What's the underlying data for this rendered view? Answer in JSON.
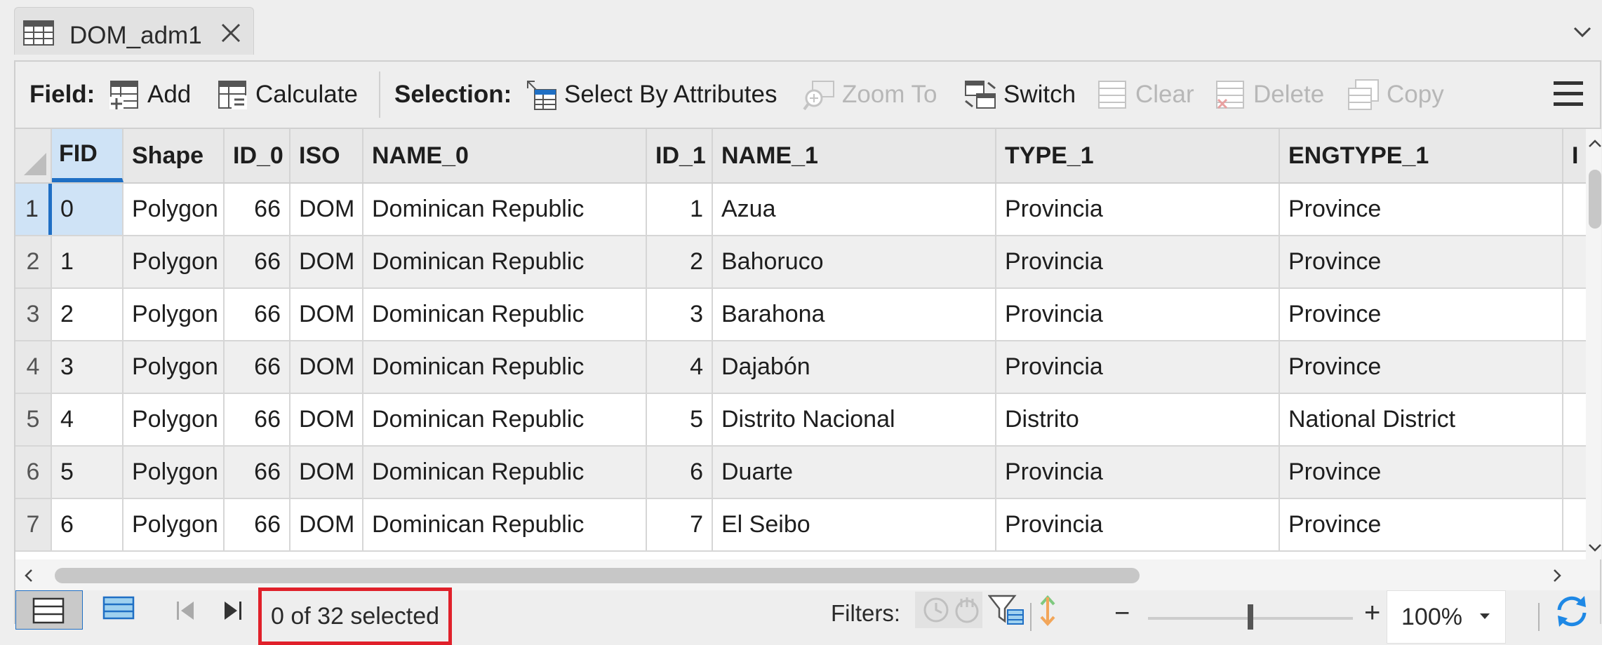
{
  "tab": {
    "title": "DOM_adm1",
    "icon": "table-icon",
    "close_icon": "close-icon"
  },
  "toolbar": {
    "field_label": "Field:",
    "add_label": "Add",
    "calculate_label": "Calculate",
    "selection_label": "Selection:",
    "select_by_attributes_label": "Select By Attributes",
    "zoom_to_label": "Zoom To",
    "switch_label": "Switch",
    "clear_label": "Clear",
    "delete_label": "Delete",
    "copy_label": "Copy"
  },
  "table": {
    "columns": [
      "FID",
      "Shape",
      "ID_0",
      "ISO",
      "NAME_0",
      "ID_1",
      "NAME_1",
      "TYPE_1",
      "ENGTYPE_1",
      "I"
    ],
    "rows": [
      {
        "n": "1",
        "FID": "0",
        "Shape": "Polygon",
        "ID_0": "66",
        "ISO": "DOM",
        "NAME_0": "Dominican Republic",
        "ID_1": "1",
        "NAME_1": "Azua",
        "TYPE_1": "Provincia",
        "ENGTYPE_1": "Province"
      },
      {
        "n": "2",
        "FID": "1",
        "Shape": "Polygon",
        "ID_0": "66",
        "ISO": "DOM",
        "NAME_0": "Dominican Republic",
        "ID_1": "2",
        "NAME_1": "Bahoruco",
        "TYPE_1": "Provincia",
        "ENGTYPE_1": "Province"
      },
      {
        "n": "3",
        "FID": "2",
        "Shape": "Polygon",
        "ID_0": "66",
        "ISO": "DOM",
        "NAME_0": "Dominican Republic",
        "ID_1": "3",
        "NAME_1": "Barahona",
        "TYPE_1": "Provincia",
        "ENGTYPE_1": "Province"
      },
      {
        "n": "4",
        "FID": "3",
        "Shape": "Polygon",
        "ID_0": "66",
        "ISO": "DOM",
        "NAME_0": "Dominican Republic",
        "ID_1": "4",
        "NAME_1": "Dajabón",
        "TYPE_1": "Provincia",
        "ENGTYPE_1": "Province"
      },
      {
        "n": "5",
        "FID": "4",
        "Shape": "Polygon",
        "ID_0": "66",
        "ISO": "DOM",
        "NAME_0": "Dominican Republic",
        "ID_1": "5",
        "NAME_1": "Distrito Nacional",
        "TYPE_1": "Distrito",
        "ENGTYPE_1": "National District"
      },
      {
        "n": "6",
        "FID": "5",
        "Shape": "Polygon",
        "ID_0": "66",
        "ISO": "DOM",
        "NAME_0": "Dominican Republic",
        "ID_1": "6",
        "NAME_1": "Duarte",
        "TYPE_1": "Provincia",
        "ENGTYPE_1": "Province"
      },
      {
        "n": "7",
        "FID": "6",
        "Shape": "Polygon",
        "ID_0": "66",
        "ISO": "DOM",
        "NAME_0": "Dominican Republic",
        "ID_1": "7",
        "NAME_1": "El Seibo",
        "TYPE_1": "Provincia",
        "ENGTYPE_1": "Province"
      }
    ]
  },
  "status": {
    "selection_text": "0 of 32 selected",
    "filters_label": "Filters:",
    "zoom_minus": "−",
    "zoom_plus": "+",
    "zoom_value": "100%"
  },
  "colors": {
    "accent": "#1f6fc4",
    "highlight": "#e0202a",
    "selected_cell": "#cfe3f6",
    "refresh": "#1e88e5"
  }
}
